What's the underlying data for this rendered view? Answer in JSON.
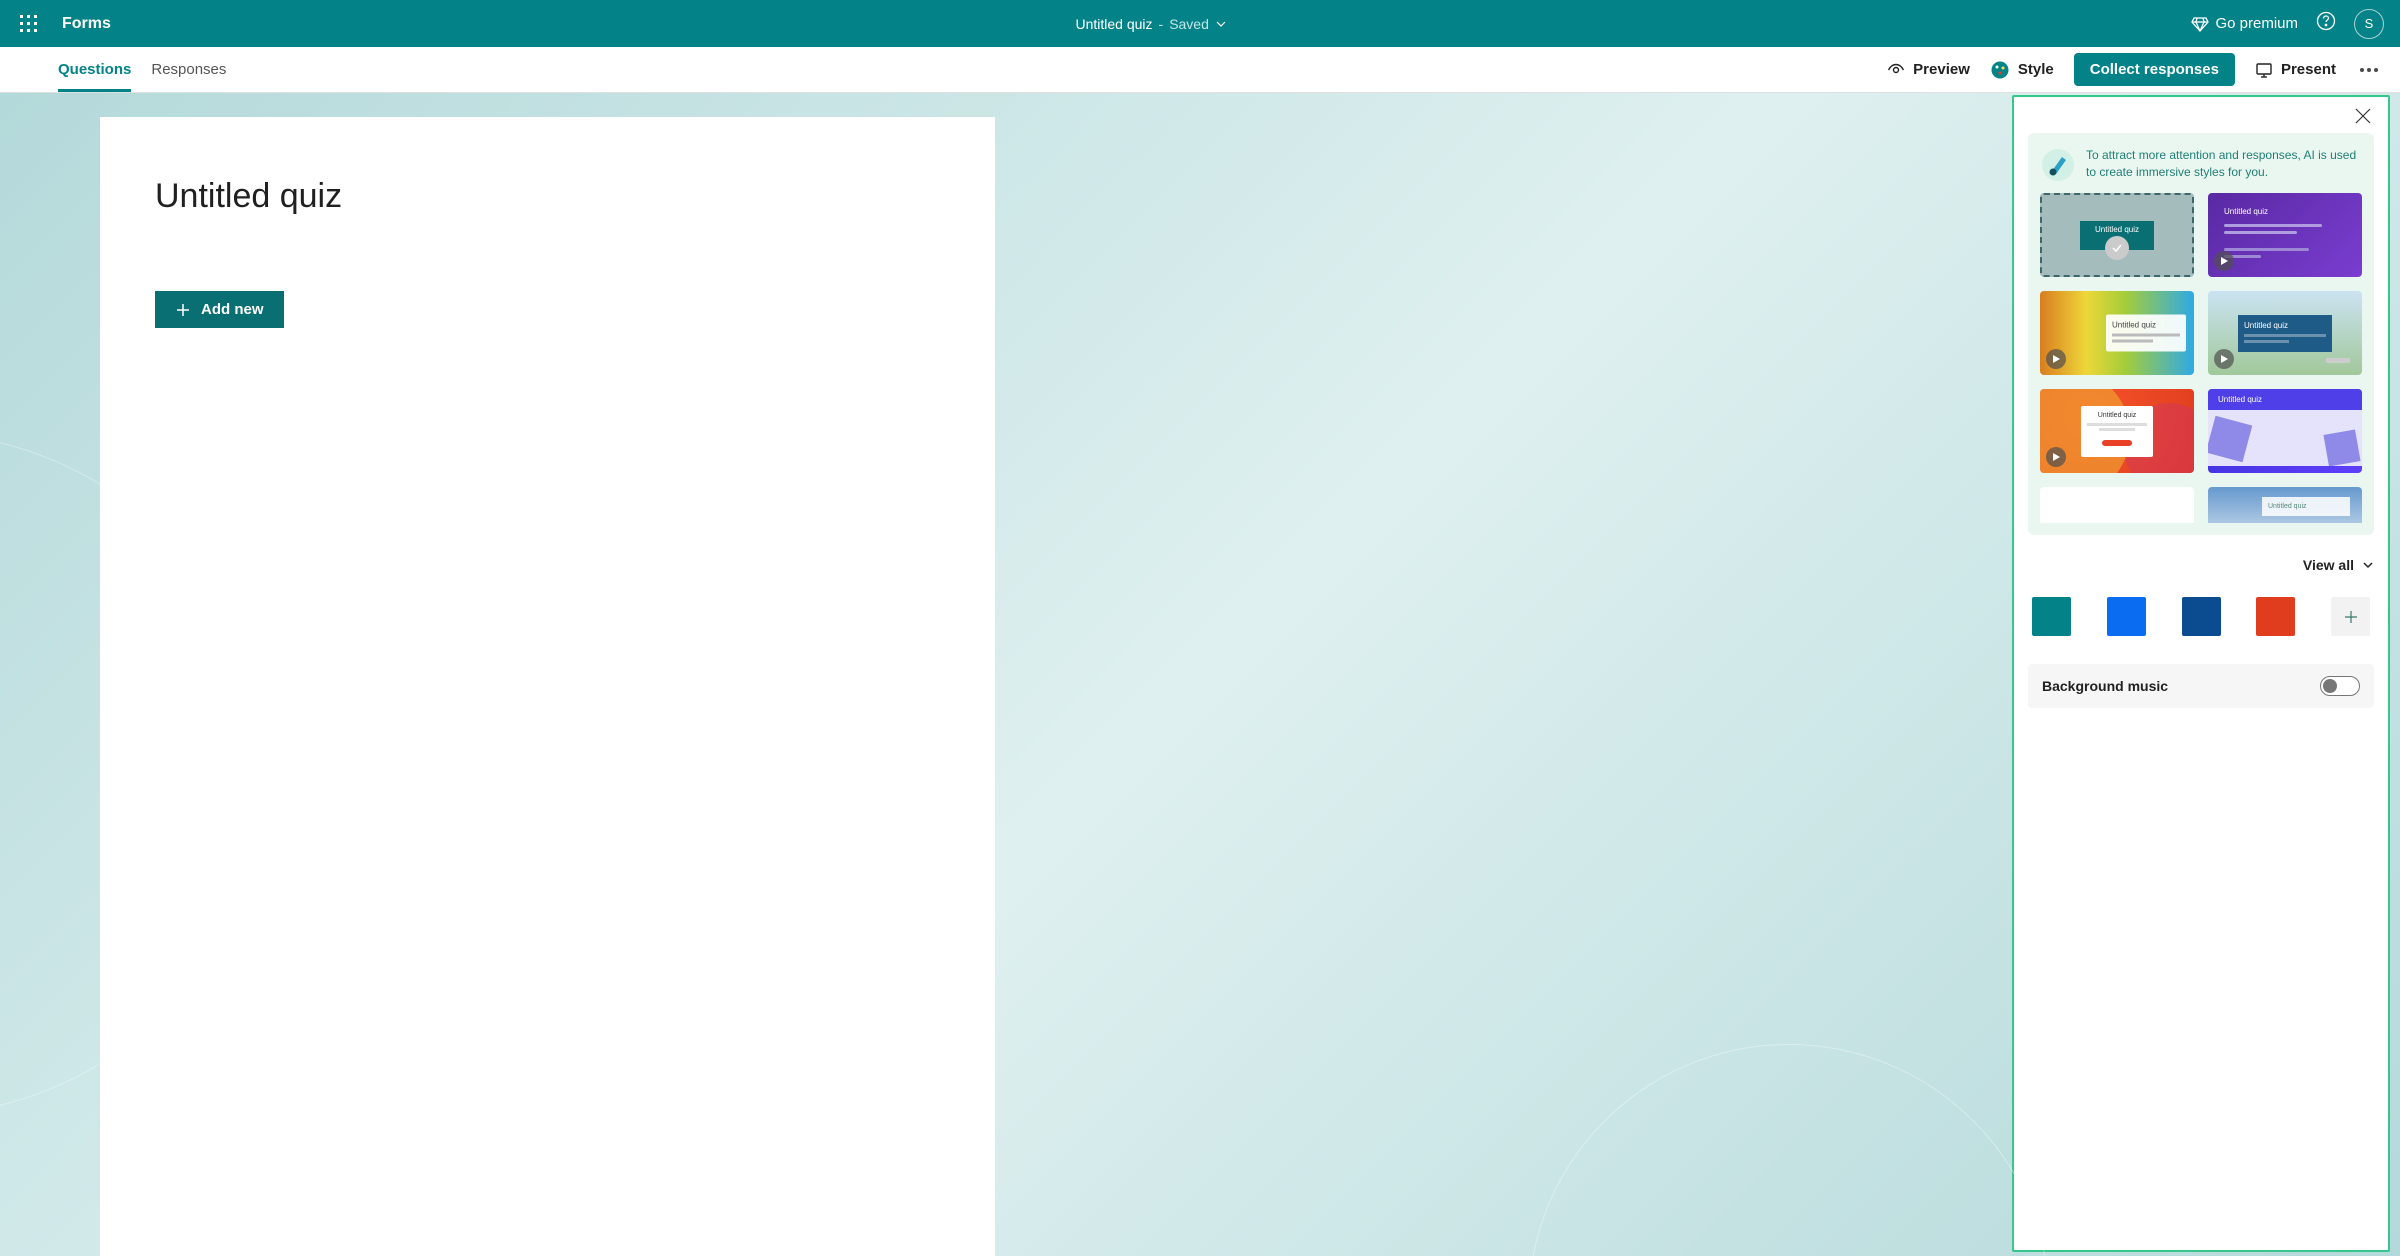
{
  "header": {
    "app_name": "Forms",
    "doc_title": "Untitled quiz",
    "doc_separator": "-",
    "doc_status": "Saved",
    "go_premium": "Go premium",
    "avatar_initial": "S"
  },
  "toolbar": {
    "tabs": [
      {
        "label": "Questions",
        "active": true
      },
      {
        "label": "Responses",
        "active": false
      }
    ],
    "preview": "Preview",
    "style": "Style",
    "collect": "Collect responses",
    "present": "Present"
  },
  "form": {
    "title": "Untitled quiz",
    "add_new": "Add new"
  },
  "style_panel": {
    "info_text": "To attract more attention and responses, AI is used to create immersive styles for you.",
    "tile_title": "Untitled quiz",
    "view_all": "View all",
    "colors": [
      "#038387",
      "#0a6cf0",
      "#0a4c8f",
      "#e03d1e"
    ],
    "bgm_label": "Background music",
    "bgm_on": false
  }
}
